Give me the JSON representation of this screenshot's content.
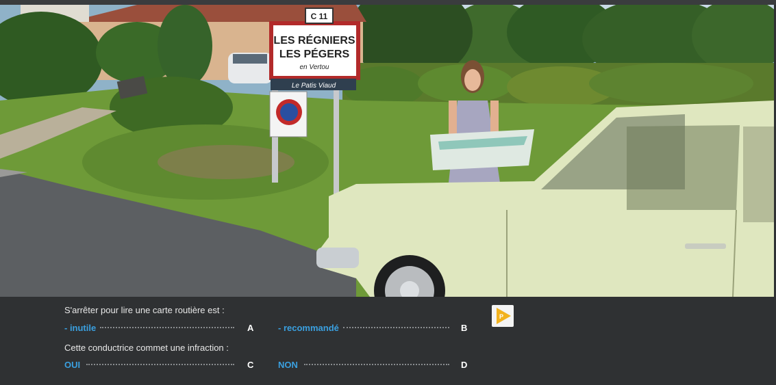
{
  "scene": {
    "sign_town_line1": "LES RÉGNIERS",
    "sign_town_line2": "LES PÉGERS",
    "sign_town_line3": "en Vertou",
    "sign_road": "C 11",
    "sign_street": "Le Patis Viaud"
  },
  "question1": {
    "text": "S'arrêter pour lire une carte routière est :",
    "answer_a": "- inutile",
    "key_a": "A",
    "answer_b": "- recommandé",
    "key_b": "B"
  },
  "question2": {
    "text": "Cette conductrice commet une infraction :",
    "answer_c": "OUI",
    "key_c": "C",
    "answer_d": "NON",
    "key_d": "D"
  },
  "play_button": {
    "icon": "play-icon",
    "color": "#f2b21e"
  },
  "colors": {
    "answer": "#3aa0e0",
    "panel": "#2f3133"
  }
}
